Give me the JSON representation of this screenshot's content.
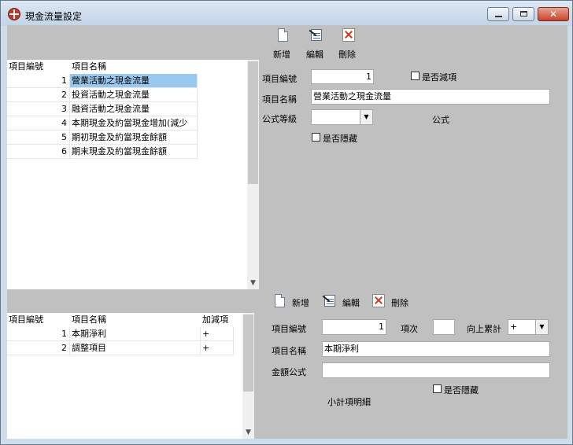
{
  "window": {
    "title": "現金流量設定"
  },
  "toolbar_top": {
    "add": "新增",
    "edit": "編輯",
    "delete": "刪除"
  },
  "toolbar_bottom": {
    "add": "新增",
    "edit": "編輯",
    "delete": "刪除"
  },
  "top_grid": {
    "headers": [
      "項目編號",
      "項目名稱"
    ],
    "rows": [
      {
        "no": "1",
        "name": "營業活動之現金流量"
      },
      {
        "no": "2",
        "name": "投資活動之現金流量"
      },
      {
        "no": "3",
        "name": "融資活動之現金流量"
      },
      {
        "no": "4",
        "name": "本期現金及約當現金增加(減少"
      },
      {
        "no": "5",
        "name": "期初現金及約當現金餘額"
      },
      {
        "no": "6",
        "name": "期末現金及約當現金餘額"
      }
    ]
  },
  "top_form": {
    "item_no_label": "項目編號",
    "item_no_value": "1",
    "subtract_label": "是否減項",
    "item_name_label": "項目名稱",
    "item_name_value": "營業活動之現金流量",
    "formula_level_label": "公式等級",
    "formula_level_value": "",
    "formula_label": "公式",
    "hidden_label": "是否隱藏"
  },
  "bottom_grid": {
    "headers": [
      "項目編號",
      "項目名稱",
      "加減項"
    ],
    "rows": [
      {
        "no": "1",
        "name": "本期淨利",
        "sign": "+"
      },
      {
        "no": "2",
        "name": "調整項目",
        "sign": "+"
      }
    ]
  },
  "bottom_form": {
    "item_no_label": "項目編號",
    "item_no_value": "1",
    "order_label": "項次",
    "order_value": "",
    "cumulative_label": "向上累計",
    "cumulative_value": "+",
    "item_name_label": "項目名稱",
    "item_name_value": "本期淨利",
    "amount_formula_label": "金額公式",
    "amount_formula_value": "",
    "hidden_label": "是否隱藏",
    "subtotal_detail_label": "小計項明細"
  }
}
